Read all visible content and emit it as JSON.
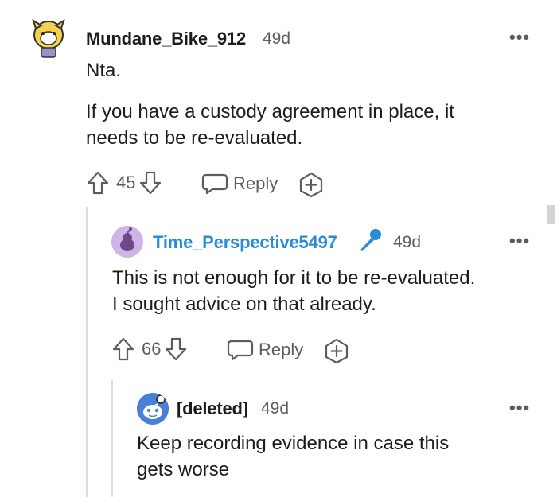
{
  "comments": [
    {
      "username": "Mundane_Bike_912",
      "time": "49d",
      "body": [
        "Nta.",
        "If you have a custody agreement in place, it",
        "needs to be re-evaluated."
      ],
      "score": "45",
      "reply_label": "Reply"
    },
    {
      "username": "Time_Perspective5497",
      "username_color": "#2a8cd8",
      "time": "49d",
      "body": [
        "This is not enough for it to be re-evaluated.",
        "I sought advice on that already."
      ],
      "score": "66",
      "reply_label": "Reply"
    },
    {
      "username": "[deleted]",
      "time": "49d",
      "body": [
        "Keep recording evidence in case this",
        "gets worse"
      ]
    }
  ],
  "more_label": "•••",
  "colors": {
    "accent_blue": "#2a8cd8",
    "muted": "#5c5c5c",
    "line": "#dcdcdc"
  }
}
